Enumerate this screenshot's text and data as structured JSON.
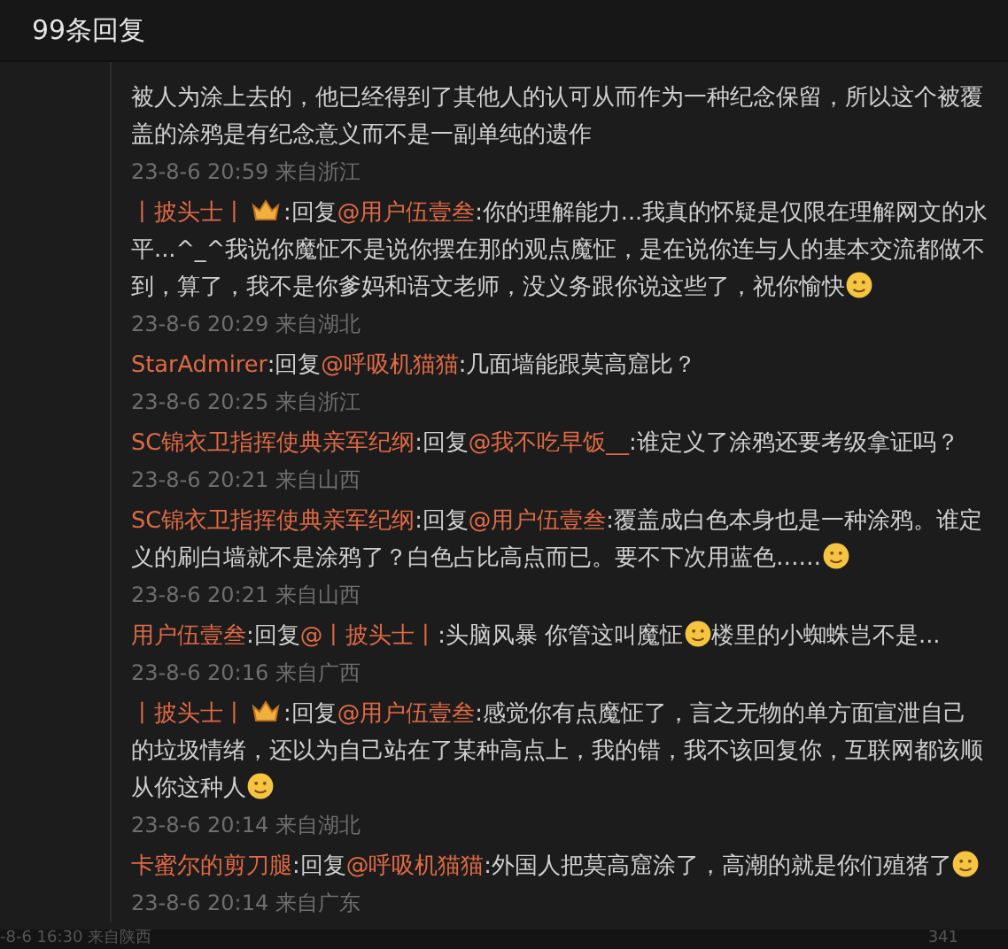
{
  "header": {
    "title": "99条回复"
  },
  "comments": [
    {
      "body": [
        {
          "kind": "text",
          "text": "被人为涂上去的，他已经得到了其他人的认可从而作为一种纪念保留，所以这个被覆盖的涂鸦是有纪念意义而不是一副单纯的遗作"
        }
      ],
      "time": "23-8-6 20:59 来自浙江"
    },
    {
      "author": "丨披头士丨",
      "badge": true,
      "reply_label": ":回复",
      "reply_to": "@用户伍壹叁",
      "body": [
        {
          "kind": "text",
          "text": ":你的理解能力...我真的怀疑是仅限在理解网文的水平...^_^我说你魔怔不是说你摆在那的观点魔怔，是在说你连与人的基本交流都做不到，算了，我不是你爹妈和语文老师，没义务跟你说这些了，祝你愉快"
        },
        {
          "kind": "emoji"
        }
      ],
      "time": "23-8-6 20:29 来自湖北"
    },
    {
      "author": "StarAdmirer",
      "badge": false,
      "reply_label": ":回复",
      "reply_to": "@呼吸机猫猫",
      "body": [
        {
          "kind": "text",
          "text": ":几面墙能跟莫高窟比？"
        }
      ],
      "time": "23-8-6 20:25 来自浙江"
    },
    {
      "author": "SC锦衣卫指挥使典亲军纪纲",
      "badge": false,
      "reply_label": ":回复",
      "reply_to": "@我不吃早饭__",
      "body": [
        {
          "kind": "text",
          "text": ":谁定义了涂鸦还要考级拿证吗？"
        }
      ],
      "time": "23-8-6 20:21 来自山西"
    },
    {
      "author": "SC锦衣卫指挥使典亲军纪纲",
      "badge": false,
      "reply_label": ":回复",
      "reply_to": "@用户伍壹叁",
      "body": [
        {
          "kind": "text",
          "text": ":覆盖成白色本身也是一种涂鸦。谁定义的刷白墙就不是涂鸦了？白色占比高点而已。要不下次用蓝色……"
        },
        {
          "kind": "emoji"
        }
      ],
      "time": "23-8-6 20:21 来自山西"
    },
    {
      "author": "用户伍壹叁",
      "badge": false,
      "reply_label": ":回复",
      "reply_to": "@丨披头士丨",
      "body": [
        {
          "kind": "text",
          "text": ":头脑风暴 你管这叫魔怔"
        },
        {
          "kind": "emoji"
        },
        {
          "kind": "text",
          "text": "楼里的小蜘蛛岂不是..."
        }
      ],
      "time": "23-8-6 20:16 来自广西"
    },
    {
      "author": "丨披头士丨",
      "badge": true,
      "reply_label": ":回复",
      "reply_to": "@用户伍壹叁",
      "body": [
        {
          "kind": "text",
          "text": ":感觉你有点魔怔了，言之无物的单方面宣泄自己的垃圾情绪，还以为自己站在了某种高点上，我的错，我不该回复你，互联网都该顺从你这种人"
        },
        {
          "kind": "emoji"
        }
      ],
      "time": "23-8-6 20:14 来自湖北"
    },
    {
      "author": "卡蜜尔的剪刀腿",
      "badge": false,
      "reply_label": ":回复",
      "reply_to": "@呼吸机猫猫",
      "body": [
        {
          "kind": "text",
          "text": ":外国人把莫高窟涂了，高潮的就是你们殖猪了"
        },
        {
          "kind": "emoji"
        }
      ],
      "time": "23-8-6 20:14 来自广东"
    }
  ],
  "footer": {
    "time": "-8-6 16:30 来自陕西",
    "count": "341"
  }
}
